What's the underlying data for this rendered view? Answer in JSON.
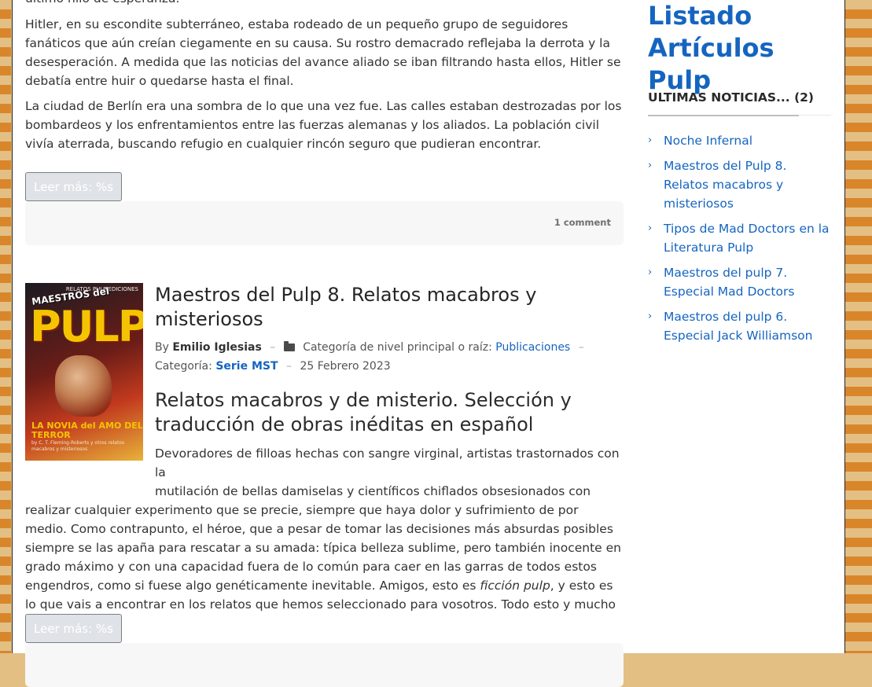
{
  "article1": {
    "intro_cut": "último hilo de esperanza.",
    "para1": "Hitler, en su escondite subterráneo, estaba rodeado de un pequeño grupo de seguidores  fanáticos que aún creían ciegamente en su causa. Su rostro demacrado reflejaba la derrota y la desesperación. A medida que las noticias del avance aliado se iban filtrando hasta ellos, Hitler se debatía entre huir o quedarse hasta el final.",
    "para2": "La ciudad de Berlín era una sombra de lo que una vez fue. Las calles estaban destrozadas por  los bombardeos y los enfrentamientos entre las fuerzas alemanas y los aliados. La población civil  vivía aterrada, buscando refugio en cualquier rincón seguro que pudieran encontrar.",
    "read_more": "Leer más: %s",
    "comments": "1 comment"
  },
  "article2": {
    "thumb": {
      "masthead": "MAESTROS del",
      "pulp": "PULP",
      "top_small": "RELATOS PULP EDICIONES",
      "novia": "LA NOVIA del AMO DEL TERROR",
      "sub": "by C. T. Fleming-Roberts y otros relatos macabros y misteriosos"
    },
    "title": "Maestros del Pulp 8. Relatos macabros y misteriosos",
    "by_label": "By",
    "author": "Emilio Iglesias",
    "parent_cat_label": "Categoría de nivel principal o raíz:",
    "parent_cat": "Publicaciones",
    "cat_label": "Categoría:",
    "cat": "Serie MST",
    "date": "25 Febrero 2023",
    "subtitle": "Relatos macabros y de misterio. Selección y traducción de obras inéditas en español",
    "body_line1": "Devoradores de filloas hechas con sangre virginal, artistas trastornados con la",
    "body_line2": "mutilación de bellas damiselas y científicos chiflados obsesionados con",
    "body_rest_a": "realizar cualquier experimento que se precie, siempre que haya dolor y sufrimiento de por medio. Como contrapunto, el héroe, que a pesar de tomar las decisiones más absurdas posibles siempre se las apaña para rescatar a su amada: típica belleza sublime, pero también inocente en grado máximo y con una capacidad fuera de lo común para caer en las garras de todos estos engendros, como si fuese algo genéticamente inevitable. Amigos, esto es ",
    "body_em": "ficción pulp",
    "body_rest_b": ", y esto es lo que vais a encontrar en los relatos que hemos seleccionado para vosotros. Todo esto y mucho más.",
    "read_more": "Leer más: %s"
  },
  "sidebar": {
    "title": "Listado Artículos Pulp",
    "widget_title": "ULTIMAS NOTICIAS... (2)",
    "items": [
      {
        "label": "Noche Infernal"
      },
      {
        "label": "Maestros del Pulp 8. Relatos macabros y misteriosos"
      },
      {
        "label": "Tipos de Mad Doctors en la Literatura Pulp"
      },
      {
        "label": "Maestros del pulp 7. Especial Mad Doctors"
      },
      {
        "label": "Maestros del pulp 6. Especial Jack Williamson"
      }
    ]
  },
  "colors": {
    "link": "#1565c0",
    "background_stripe": "#d9862a",
    "background_base": "#e3bf84"
  }
}
